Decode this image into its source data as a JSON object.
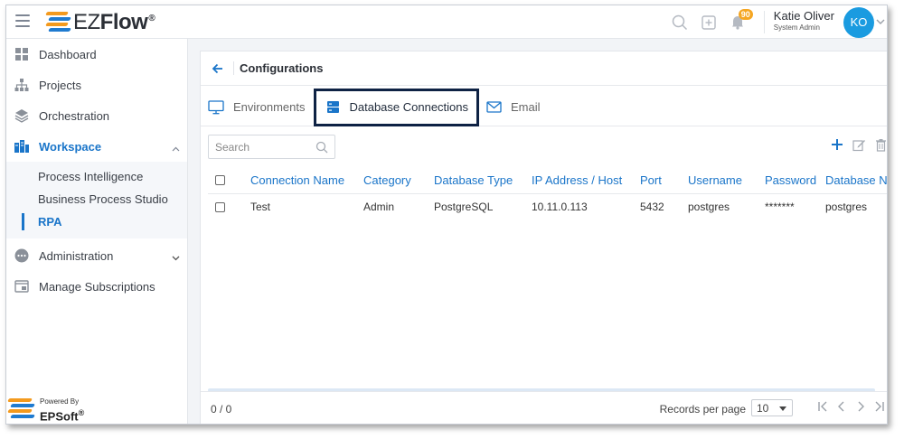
{
  "app": {
    "name_prefix": "EZ",
    "name_suffix": "Flow",
    "registered": "®"
  },
  "topbar": {
    "notification_count": "90",
    "user_name": "Katie Oliver",
    "user_role": "System Admin",
    "avatar_initials": "KO"
  },
  "sidebar": {
    "items": [
      {
        "label": "Dashboard",
        "icon": "grid-icon"
      },
      {
        "label": "Projects",
        "icon": "hierarchy-icon"
      },
      {
        "label": "Orchestration",
        "icon": "layers-icon"
      },
      {
        "label": "Workspace",
        "icon": "workspace-icon",
        "active": true,
        "expanded": true
      },
      {
        "label": "Administration",
        "icon": "more-circle-icon",
        "expanded": false
      },
      {
        "label": "Manage Subscriptions",
        "icon": "subscription-icon"
      }
    ],
    "workspace_sub": [
      "Process Intelligence",
      "Business Process Studio",
      "RPA"
    ],
    "powered_by": "Powered By",
    "powered_name": "EPSoft",
    "powered_reg": "®"
  },
  "panel": {
    "title": "Configurations",
    "tabs": [
      "Environments",
      "Database Connections",
      "Email"
    ],
    "active_tab": "Database Connections",
    "search_placeholder": "Search",
    "columns": [
      "Connection Name",
      "Category",
      "Database Type",
      "IP Address / Host",
      "Port",
      "Username",
      "Password",
      "Database Na"
    ],
    "rows": [
      [
        "Test",
        "Admin",
        "PostgreSQL",
        "10.11.0.113",
        "5432",
        "postgres",
        "*******",
        "postgres"
      ]
    ],
    "record_count": "0 / 0",
    "records_per_page_label": "Records per page",
    "records_per_page_value": "10"
  },
  "colors": {
    "accent": "#1a75c9",
    "avatar": "#1a9be0",
    "badge": "#f5a623",
    "active_tab_border": "#0e2244",
    "logo_blue": "#1f7bd0",
    "logo_orange": "#f39a1e"
  }
}
